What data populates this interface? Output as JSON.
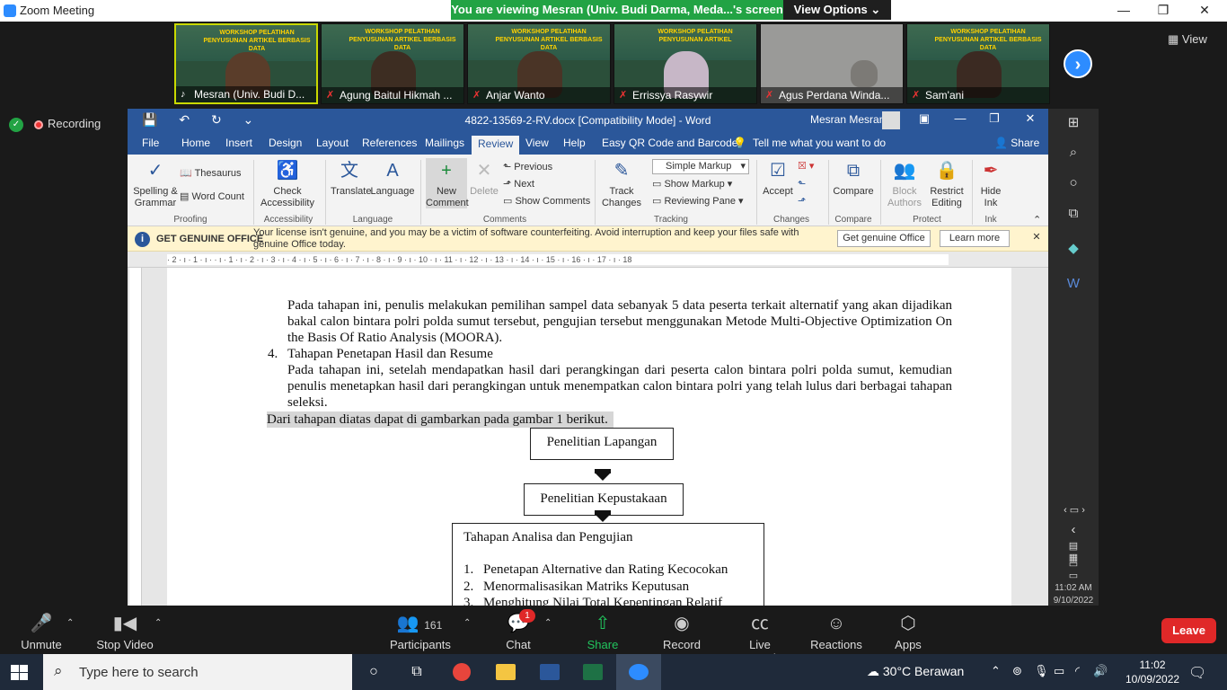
{
  "zoom": {
    "title": "Zoom Meeting",
    "share_banner": "You are viewing Mesran (Univ. Budi Darma, Meda...'s screen",
    "view_options": "View Options",
    "gallery_view": "View",
    "recording": "Recording",
    "participants_thumbs": [
      {
        "name": "Mesran (Univ. Budi D...",
        "title": "WORKSHOP PELATIHAN PENYUSUNAN ARTIKEL BERBASIS DATA",
        "muted": false
      },
      {
        "name": "Agung Baitul Hikmah ...",
        "title": "WORKSHOP PELATIHAN PENYUSUNAN ARTIKEL BERBASIS DATA",
        "muted": true
      },
      {
        "name": "Anjar Wanto",
        "title": "WORKSHOP PELATIHAN PENYUSUNAN ARTIKEL BERBASIS DATA",
        "muted": true
      },
      {
        "name": "Errissya Rasywir",
        "title": "WORKSHOP PELATIHAN PENYUSUNAN ARTIKEL",
        "muted": true
      },
      {
        "name": "Agus Perdana Winda...",
        "title": "",
        "muted": true
      },
      {
        "name": "Sam'ani",
        "title": "WORKSHOP PELATIHAN PENYUSUNAN ARTIKEL BERBASIS DATA",
        "muted": true
      }
    ],
    "toolbar": {
      "unmute": "Unmute",
      "stop_video": "Stop Video",
      "participants": "Participants",
      "participants_count": "161",
      "chat": "Chat",
      "chat_badge": "1",
      "share_screen": "Share Screen",
      "record": "Record",
      "live_transcript": "Live Transcript",
      "reactions": "Reactions",
      "apps": "Apps",
      "leave": "Leave"
    }
  },
  "word": {
    "doc_title": "4822-13569-2-RV.docx [Compatibility Mode]  -  Word",
    "user": "Mesran Mesran",
    "tabs": [
      "File",
      "Home",
      "Insert",
      "Design",
      "Layout",
      "References",
      "Mailings",
      "Review",
      "View",
      "Help",
      "Easy QR Code and Barcode"
    ],
    "tell_me": "Tell me what you want to do",
    "share": "Share",
    "ribbon": {
      "spelling": "Spelling & Grammar",
      "thesaurus": "Thesaurus",
      "word_count": "Word Count",
      "proofing": "Proofing",
      "check_accessibility": "Check Accessibility",
      "accessibility": "Accessibility",
      "translate": "Translate",
      "language_btn": "Language",
      "language": "Language",
      "new_comment": "New Comment",
      "delete": "Delete",
      "previous": "Previous",
      "next": "Next",
      "show_comments": "Show Comments",
      "comments": "Comments",
      "track_changes": "Track Changes",
      "simple_markup": "Simple Markup",
      "show_markup": "Show Markup",
      "reviewing_pane": "Reviewing Pane",
      "tracking": "Tracking",
      "accept": "Accept",
      "changes": "Changes",
      "compare_btn": "Compare",
      "compare": "Compare",
      "block_authors": "Block Authors",
      "restrict_editing": "Restrict Editing",
      "protect": "Protect",
      "hide_ink": "Hide Ink",
      "ink": "Ink"
    },
    "notice": {
      "heading": "GET GENUINE OFFICE",
      "message": "Your license isn't genuine, and you may be a victim of software counterfeiting. Avoid interruption and keep your files safe with genuine Office today.",
      "get_genuine": "Get genuine Office",
      "learn_more": "Learn more"
    },
    "ruler": "· 2 · ı · 1 · ı ·  · ı · 1 · ı · 2 · ı · 3 · ı · 4 · ı · 5 · ı · 6 · ı · 7 · ı · 8 · ı · 9 · ı · 10 · ı · 11 · ı · 12 · ı · 13 · ı · 14 · ı · 15 · ı · 16 · ı · 17 · ı · 18",
    "document": {
      "para1": "Pada tahapan ini, penulis melakukan pemilihan sampel data sebanyak 5 data peserta terkait alternatif yang akan dijadikan bakal calon bintara polri polda sumut tersebut, pengujian tersebut menggunakan Metode Multi-Objective Optimization On the Basis Of Ratio Analysis (MOORA).",
      "item4_num": "4.",
      "item4_title": "Tahapan Penetapan Hasil dan Resume",
      "para2": "Pada tahapan ini, setelah mendapatkan hasil dari perangkingan dari peserta calon bintara polri polda sumut, kemudian penulis menetapkan hasil dari perangkingan untuk menempatkan calon bintara polri yang telah lulus dari berbagai tahapan seleksi.",
      "para3": "Dari tahapan diatas dapat di gambarkan pada gambar 1 berikut.",
      "box1": "Penelitian Lapangan",
      "box2": "Penelitian Kepustakaan",
      "box3_title": "Tahapan Analisa dan Pengujian",
      "box3_items": [
        {
          "n": "1.",
          "t": "Penetapan Alternative dan Rating Kecocokan"
        },
        {
          "n": "2.",
          "t": "Menormalisasikan Matriks Keputusan"
        },
        {
          "n": "3.",
          "t": "Menghitung Nilai Total Kepentingan Relatif"
        }
      ]
    },
    "side_time": "11:02 AM",
    "side_date": "9/10/2022"
  },
  "taskbar": {
    "search_placeholder": "Type here to search",
    "weather": "30°C  Berawan",
    "time": "11:02",
    "date": "10/09/2022"
  }
}
